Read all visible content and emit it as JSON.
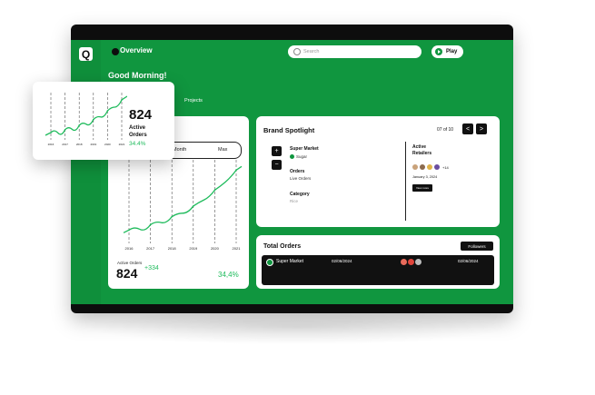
{
  "app": {
    "logo_letter": "Q"
  },
  "topbar": {
    "title": "Overview",
    "search_placeholder": "Search",
    "play_label": "Play"
  },
  "greeting": {
    "title": "Good Morning!",
    "subtitle": "ut"
  },
  "tabs": {
    "projects": "Projects"
  },
  "range": {
    "month": "Month",
    "max": "Max"
  },
  "active_orders": {
    "label": "Active Orders",
    "value": "824",
    "delta": "+334",
    "percent": "34,4%",
    "years": [
      "2016",
      "2017",
      "2018",
      "2019",
      "2020",
      "2021"
    ]
  },
  "popup": {
    "value": "824",
    "label_line1": "Active",
    "label_line2": "Orders",
    "percent": "34.4%"
  },
  "brand_spotlight": {
    "title": "Brand Spotlight",
    "pager": "07 of 10",
    "prev": "<",
    "next": ">",
    "plus": "+",
    "minus": "−",
    "name_label": "Super Market",
    "name_value": "Sugar",
    "orders_label": "Orders",
    "orders_value": "Live Orders",
    "category_label": "Category",
    "category_value": "Rice",
    "retailers_line1": "Active",
    "retailers_line2": "Retailers",
    "retailers_more": "+14",
    "retailers_date": "January 3, 2024",
    "view_more": "View more"
  },
  "total_orders": {
    "title": "Total Orders",
    "followers_label": "Followers",
    "rows": [
      {
        "name": "Super Market",
        "date1": "02/06/2024",
        "date2": "02/06/2024"
      }
    ]
  },
  "colors": {
    "brand_green": "#10963f",
    "accent_green": "#1fbb5c",
    "dark": "#111111"
  },
  "chart_data": {
    "type": "line",
    "title": "",
    "xlabel": "",
    "ylabel": "",
    "categories": [
      "2016",
      "2017",
      "2018",
      "2019",
      "2020",
      "2021"
    ],
    "values": [
      10,
      14,
      20,
      28,
      40,
      55
    ],
    "ylim": [
      0,
      60
    ]
  }
}
